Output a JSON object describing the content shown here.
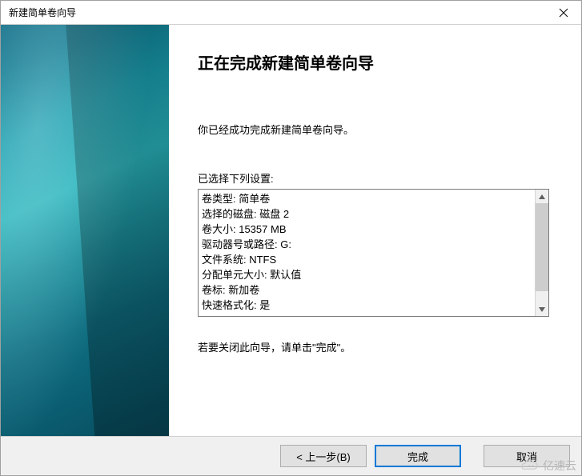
{
  "window": {
    "title": "新建简单卷向导"
  },
  "content": {
    "heading": "正在完成新建简单卷向导",
    "intro": "你已经成功完成新建简单卷向导。",
    "settings_label": "已选择下列设置:",
    "settings": [
      "卷类型: 简单卷",
      "选择的磁盘: 磁盘 2",
      "卷大小: 15357 MB",
      "驱动器号或路径: G:",
      "文件系统: NTFS",
      "分配单元大小: 默认值",
      "卷标: 新加卷",
      "快速格式化: 是"
    ],
    "closing": "若要关闭此向导，请单击\"完成\"。"
  },
  "buttons": {
    "back": "< 上一步(B)",
    "finish": "完成",
    "cancel": "取消"
  },
  "watermark": {
    "text": "亿速云"
  }
}
